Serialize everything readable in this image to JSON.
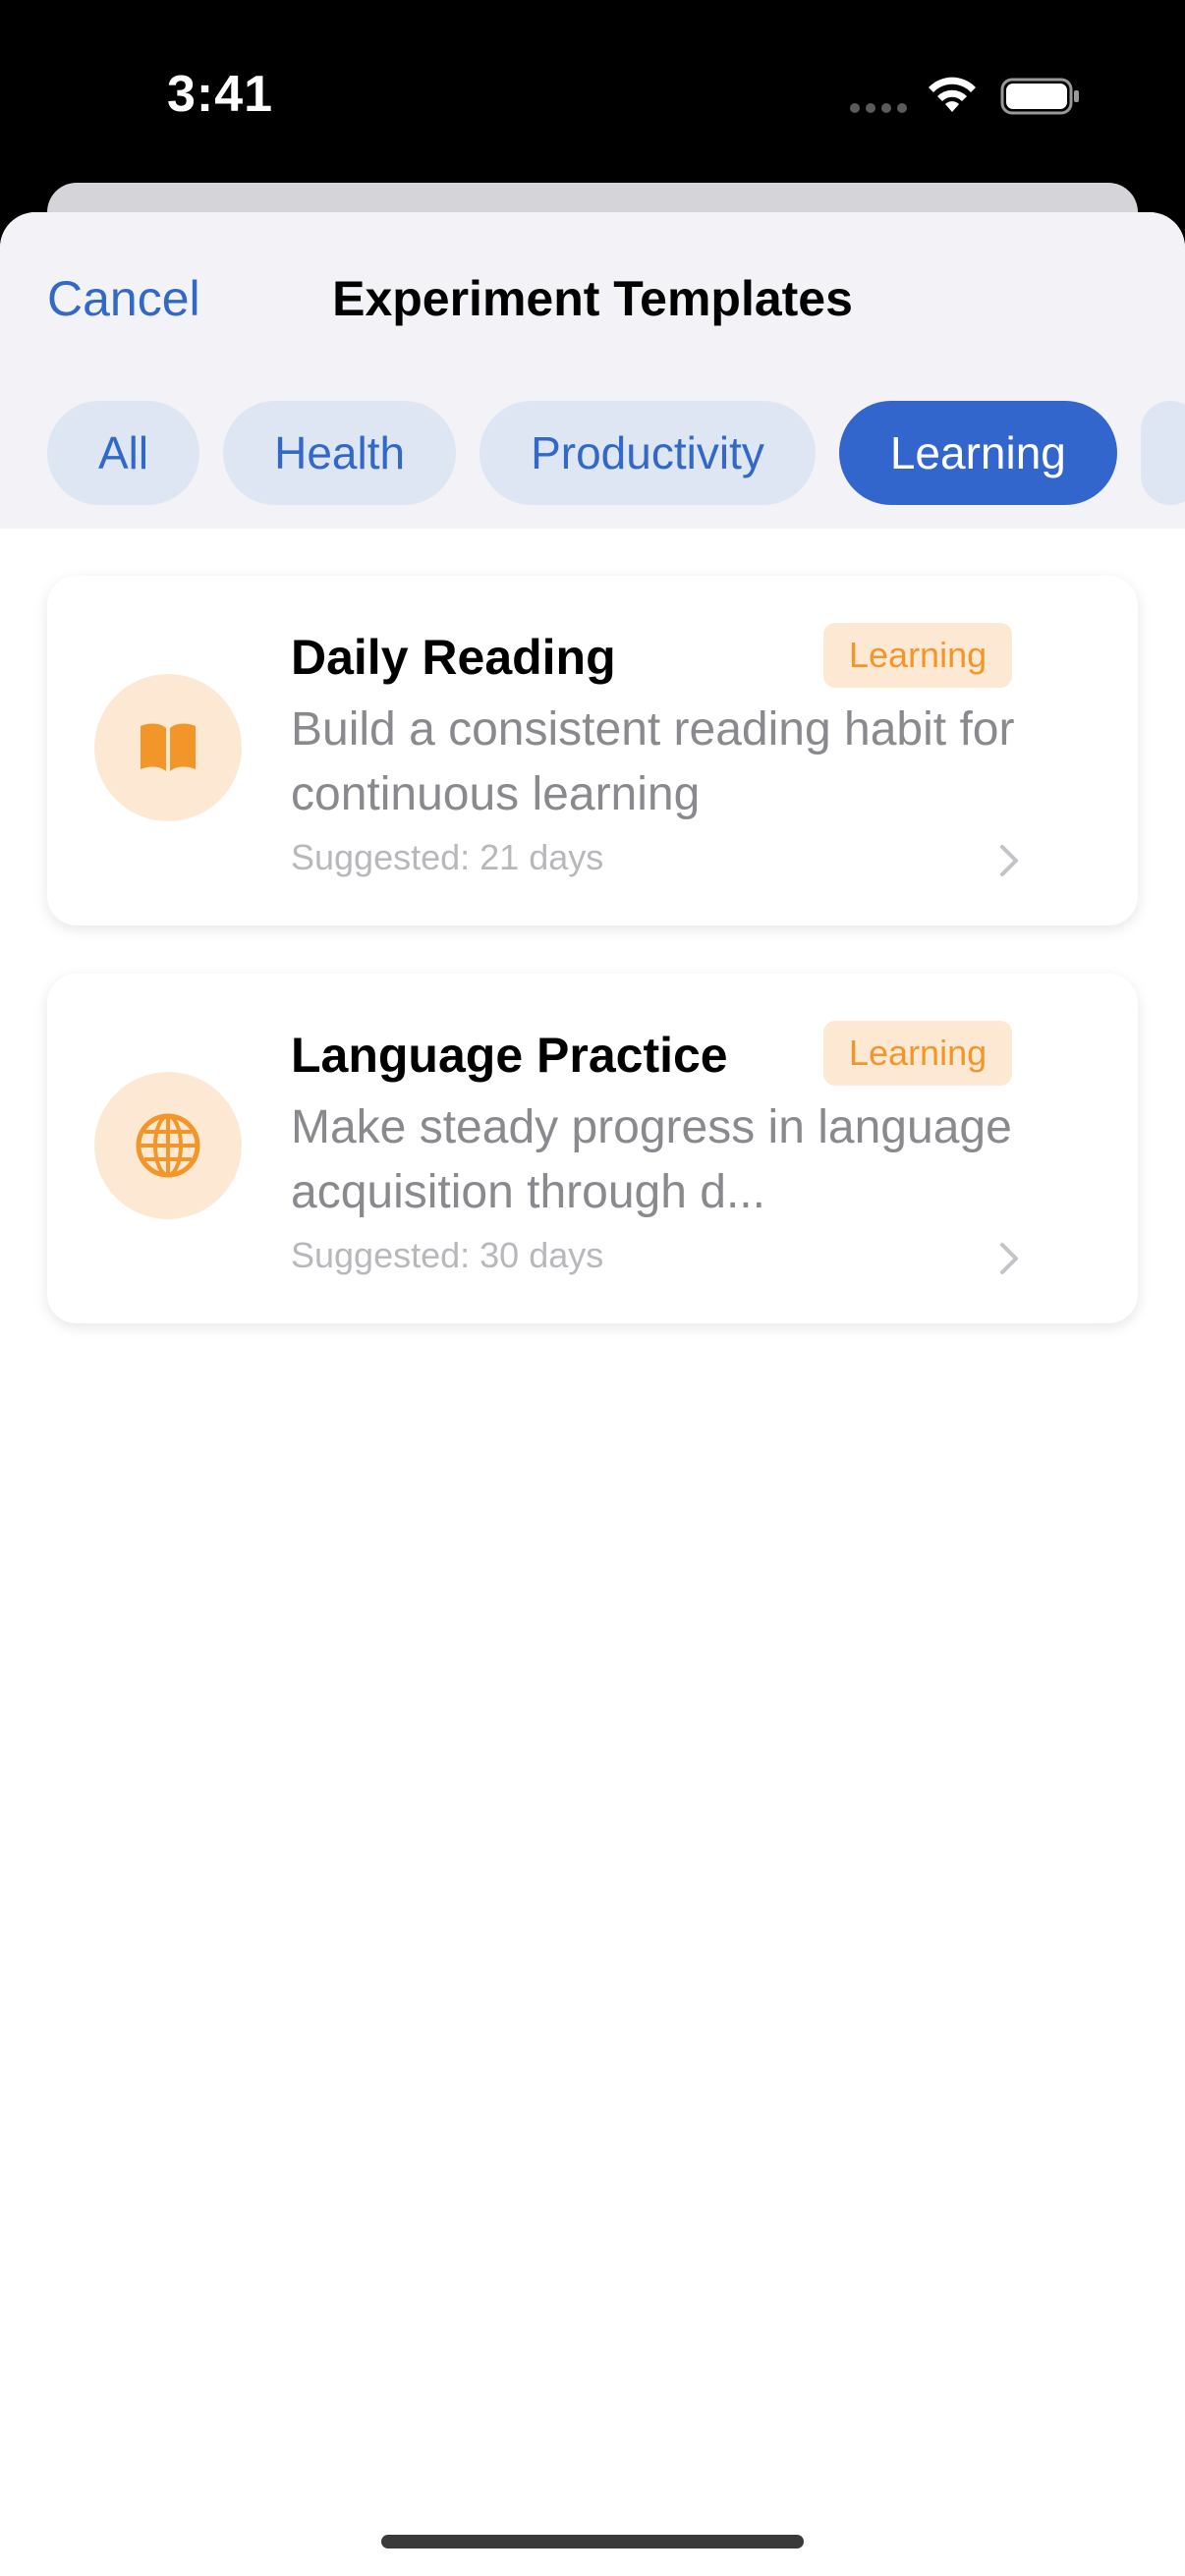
{
  "status_bar": {
    "time": "3:41"
  },
  "header": {
    "cancel_label": "Cancel",
    "title": "Experiment Templates"
  },
  "filters": [
    {
      "label": "All",
      "selected": false
    },
    {
      "label": "Health",
      "selected": false
    },
    {
      "label": "Productivity",
      "selected": false
    },
    {
      "label": "Learning",
      "selected": true
    }
  ],
  "templates": [
    {
      "title": "Daily Reading",
      "badge": "Learning",
      "description": "Build a consistent reading habit for continuous learning",
      "suggested": "Suggested: 21 days",
      "icon": "book-icon"
    },
    {
      "title": "Language Practice",
      "badge": "Learning",
      "description": "Make steady progress in language acquisition through d...",
      "suggested": "Suggested: 30 days",
      "icon": "globe-icon"
    }
  ],
  "colors": {
    "accent": "#3266cc",
    "chip_bg": "#dfe6f3",
    "orange": "#f2962a",
    "orange_bg": "#fde9d3"
  }
}
